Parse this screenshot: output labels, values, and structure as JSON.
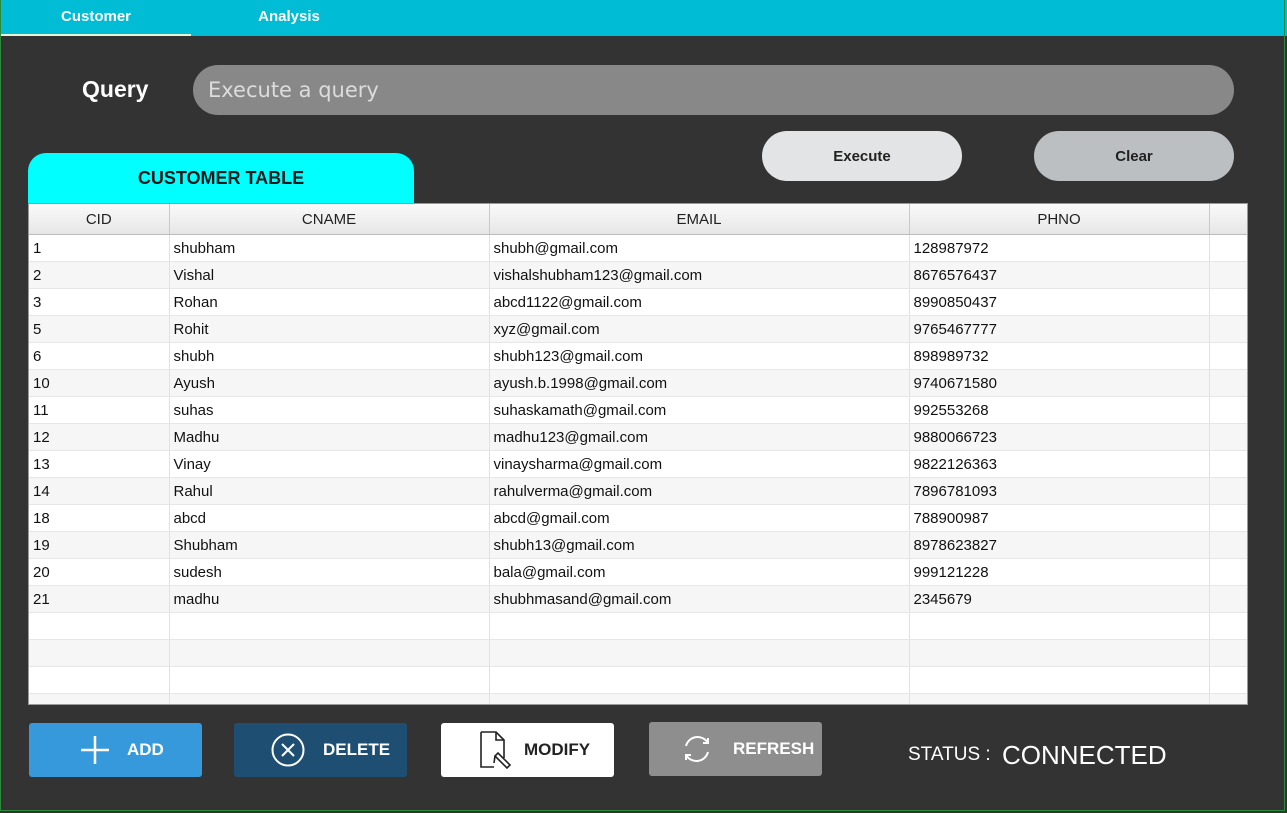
{
  "tabs": [
    {
      "label": "Customer"
    },
    {
      "label": "Analysis"
    }
  ],
  "query": {
    "label": "Query",
    "placeholder": "Execute a query",
    "value": ""
  },
  "buttons": {
    "execute": "Execute",
    "clear": "Clear",
    "add": "ADD",
    "delete": "DELETE",
    "modify": "MODIFY",
    "refresh": "REFRESH"
  },
  "table": {
    "title": "CUSTOMER TABLE",
    "columns": [
      "CID",
      "CNAME",
      "EMAIL",
      "PHNO"
    ],
    "rows": [
      [
        "1",
        "shubham",
        "shubh@gmail.com",
        "128987972"
      ],
      [
        "2",
        "Vishal",
        "vishalshubham123@gmail.com",
        "8676576437"
      ],
      [
        "3",
        "Rohan",
        "abcd1122@gmail.com",
        "8990850437"
      ],
      [
        "5",
        "Rohit",
        "xyz@gmail.com",
        "9765467777"
      ],
      [
        "6",
        "shubh",
        "shubh123@gmail.com",
        "898989732"
      ],
      [
        "10",
        "Ayush",
        "ayush.b.1998@gmail.com",
        "9740671580"
      ],
      [
        "11",
        "suhas",
        "suhaskamath@gmail.com",
        "992553268"
      ],
      [
        "12",
        "Madhu",
        "madhu123@gmail.com",
        "9880066723"
      ],
      [
        "13",
        "Vinay",
        "vinaysharma@gmail.com",
        "9822126363"
      ],
      [
        "14",
        "Rahul",
        "rahulverma@gmail.com",
        "7896781093"
      ],
      [
        "18",
        "abcd",
        "abcd@gmail.com",
        "788900987"
      ],
      [
        "19",
        "Shubham",
        "shubh13@gmail.com",
        "8978623827"
      ],
      [
        "20",
        "sudesh",
        "bala@gmail.com",
        "999121228"
      ],
      [
        "21",
        "madhu",
        "shubhmasand@gmail.com",
        "2345679"
      ]
    ]
  },
  "status": {
    "label": "STATUS :",
    "value": "CONNECTED"
  },
  "icons": {
    "add": "plus-icon",
    "delete": "circle-x-icon",
    "modify": "document-edit-icon",
    "refresh": "refresh-icon"
  },
  "colors": {
    "topbar": "#00bcd4",
    "table_tab": "#00ffff",
    "add": "#3699dc",
    "delete": "#1e4f73",
    "refresh": "#8e8e8e",
    "background": "#333333"
  }
}
